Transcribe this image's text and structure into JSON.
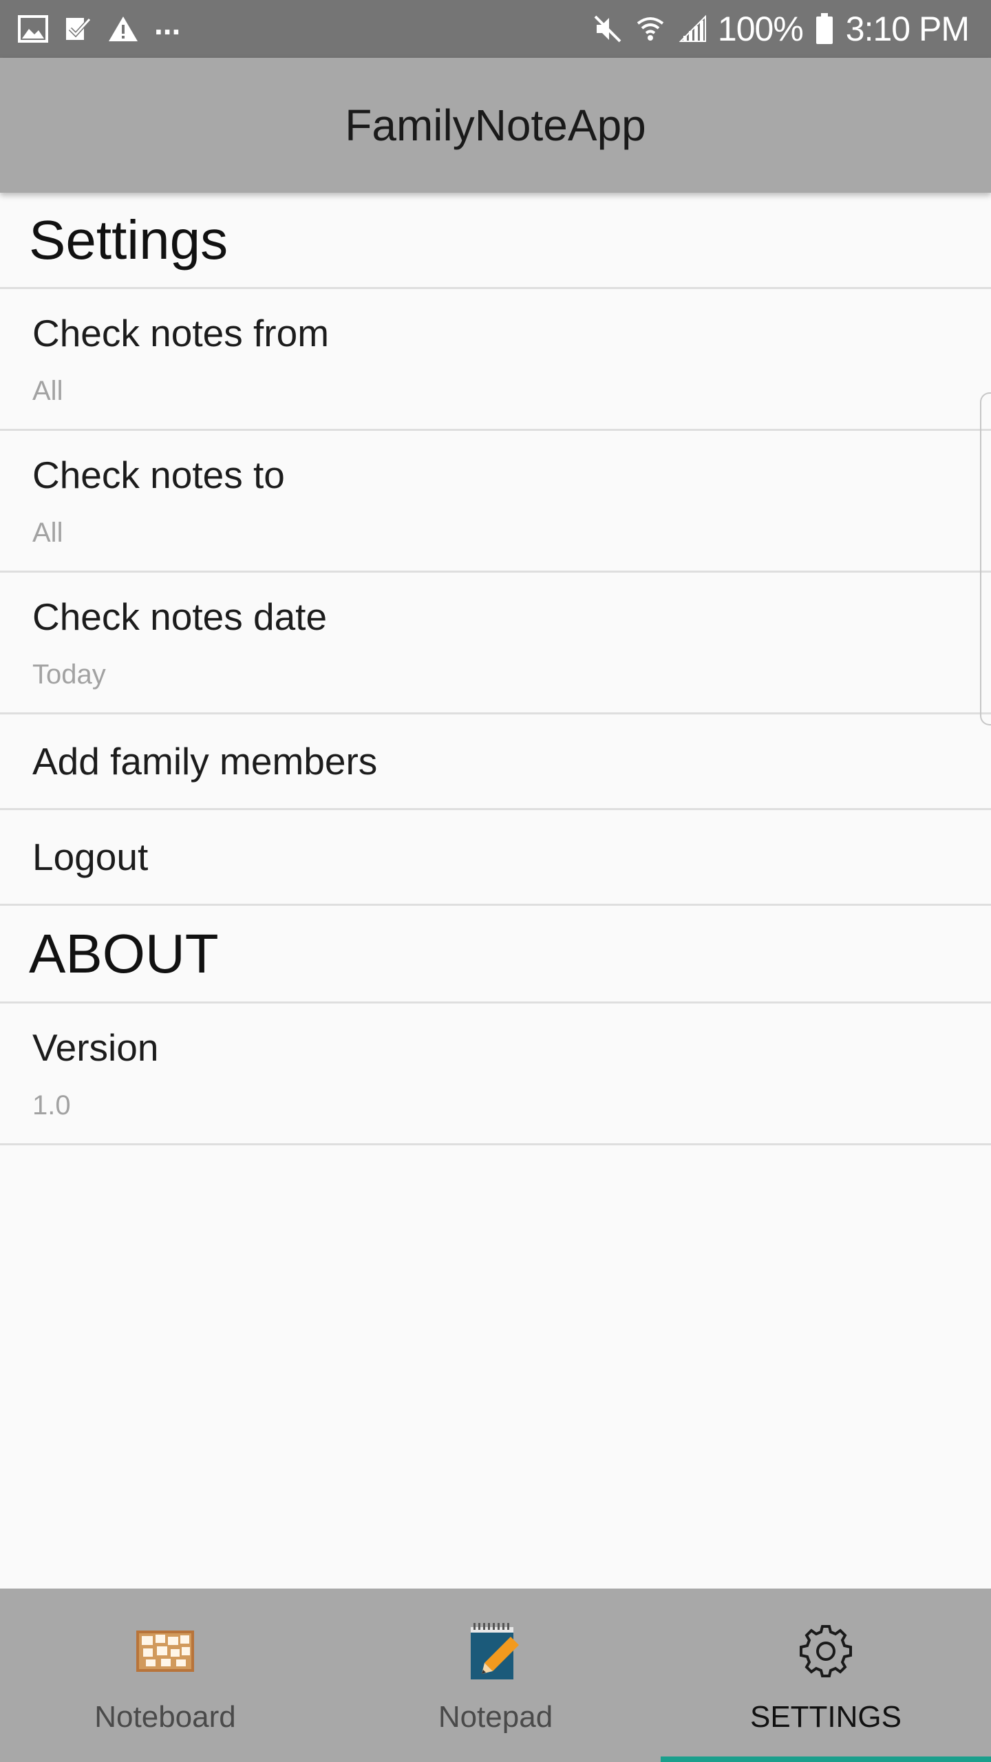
{
  "status_bar": {
    "left_icons": [
      "gallery-icon",
      "task-check-icon",
      "warning-icon"
    ],
    "overflow": "...",
    "battery": "100%",
    "time": "3:10 PM"
  },
  "app_bar": {
    "title": "FamilyNoteApp"
  },
  "settings": {
    "header": "Settings",
    "items": [
      {
        "title": "Check notes from",
        "summary": "All"
      },
      {
        "title": "Check notes to",
        "summary": "All"
      },
      {
        "title": "Check notes date",
        "summary": "Today"
      },
      {
        "title": "Add family members"
      },
      {
        "title": "Logout"
      }
    ]
  },
  "about": {
    "header": "ABOUT",
    "items": [
      {
        "title": "Version",
        "summary": "1.0"
      }
    ]
  },
  "bottom_nav": {
    "tabs": [
      {
        "label": "Noteboard",
        "icon": "corkboard-icon",
        "active": false
      },
      {
        "label": "Notepad",
        "icon": "notepad-pencil-icon",
        "active": false
      },
      {
        "label": "SETTINGS",
        "icon": "gear-icon",
        "active": true
      }
    ]
  },
  "colors": {
    "status_bar": "#757575",
    "app_bar": "#a8a8a8",
    "bottom_nav": "#a8a8a8",
    "background": "#fafafa",
    "active_indicator": "#1a9f8c",
    "summary_text": "#a2a2a2"
  }
}
